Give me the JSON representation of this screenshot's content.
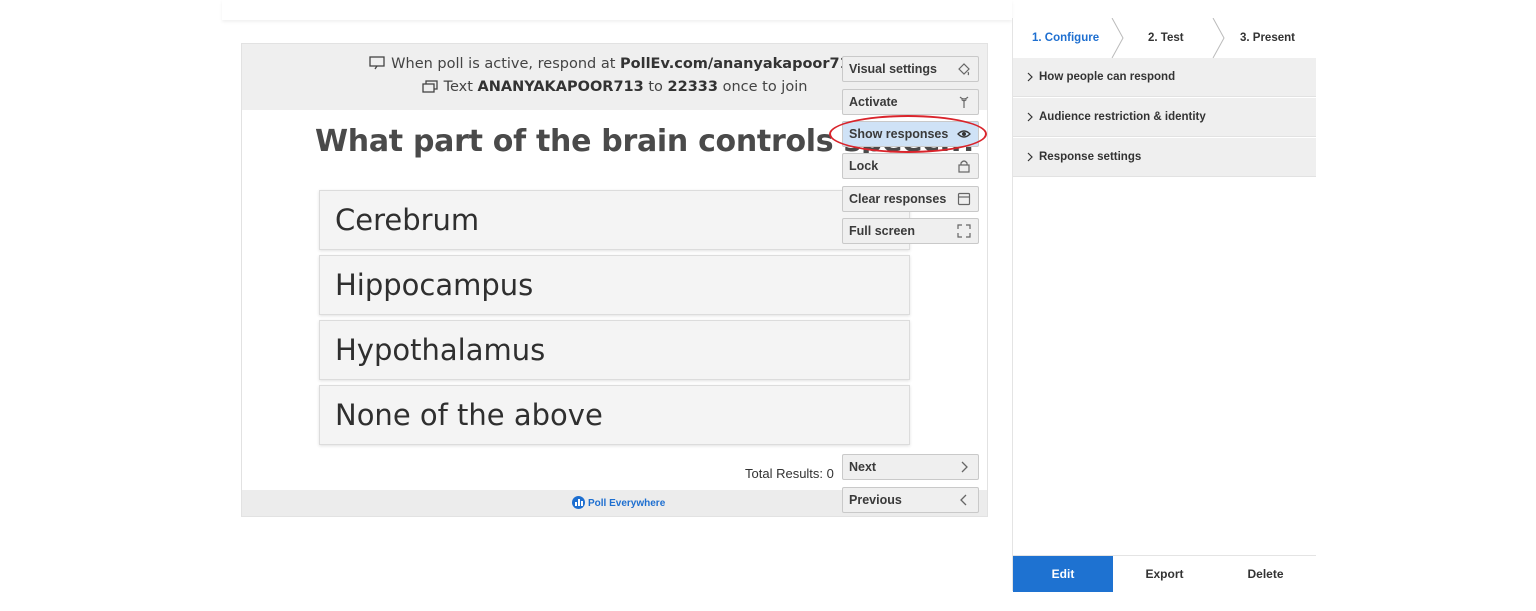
{
  "instructions": {
    "line1_prefix": "When poll is active, respond at ",
    "line1_url": "PollEv.com/ananyakapoor713",
    "line2_prefix": "Text ",
    "line2_code": "ANANYAKAPOOR713",
    "line2_mid": " to ",
    "line2_number": "22333",
    "line2_suffix": " once to join"
  },
  "poll": {
    "question": "What part of the brain controls speech?",
    "options": [
      "Cerebrum",
      "Hippocampus",
      "Hypothalamus",
      "None of the above"
    ],
    "total_results_label": "Total Results: 0",
    "brand": "Poll Everywhere"
  },
  "controls": {
    "visual_settings": "Visual settings",
    "activate": "Activate",
    "show_responses": "Show responses",
    "lock": "Lock",
    "clear_responses": "Clear responses",
    "full_screen": "Full screen",
    "next": "Next",
    "previous": "Previous"
  },
  "panel": {
    "steps": [
      "1. Configure",
      "2. Test",
      "3. Present"
    ],
    "active_step": "1. Configure",
    "sections": [
      "How people can respond",
      "Audience restriction & identity",
      "Response settings"
    ],
    "actions": {
      "edit": "Edit",
      "export": "Export",
      "delete": "Delete"
    }
  },
  "colors": {
    "accent": "#1e72d1",
    "highlight_ring": "#d9242b",
    "active_control_bg": "#cfe2f6"
  }
}
